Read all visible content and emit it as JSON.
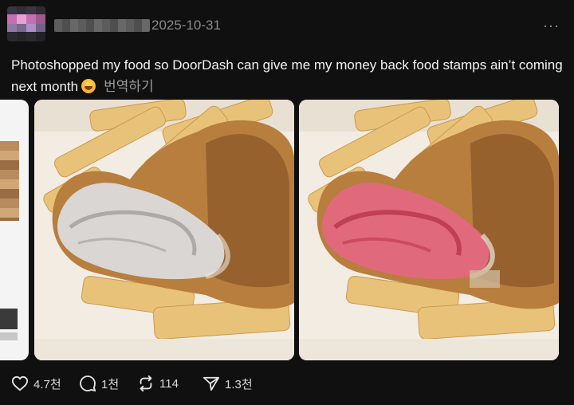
{
  "post": {
    "timestamp": "2025-10-31",
    "more": "···",
    "text": "Photoshopped my food so DoorDash can give me my money back food stamps ain’t coming next month",
    "translate_label": "번역하기"
  },
  "media": {
    "images": [
      {
        "variant": "white-meat"
      },
      {
        "variant": "raw-pink-meat"
      }
    ]
  },
  "actions": {
    "likes": "4.7천",
    "replies": "1천",
    "reposts": "114",
    "shares": "1.3천"
  },
  "colors": {
    "background": "#101010",
    "text": "#f3f3f3",
    "muted": "#8a8a8a"
  }
}
